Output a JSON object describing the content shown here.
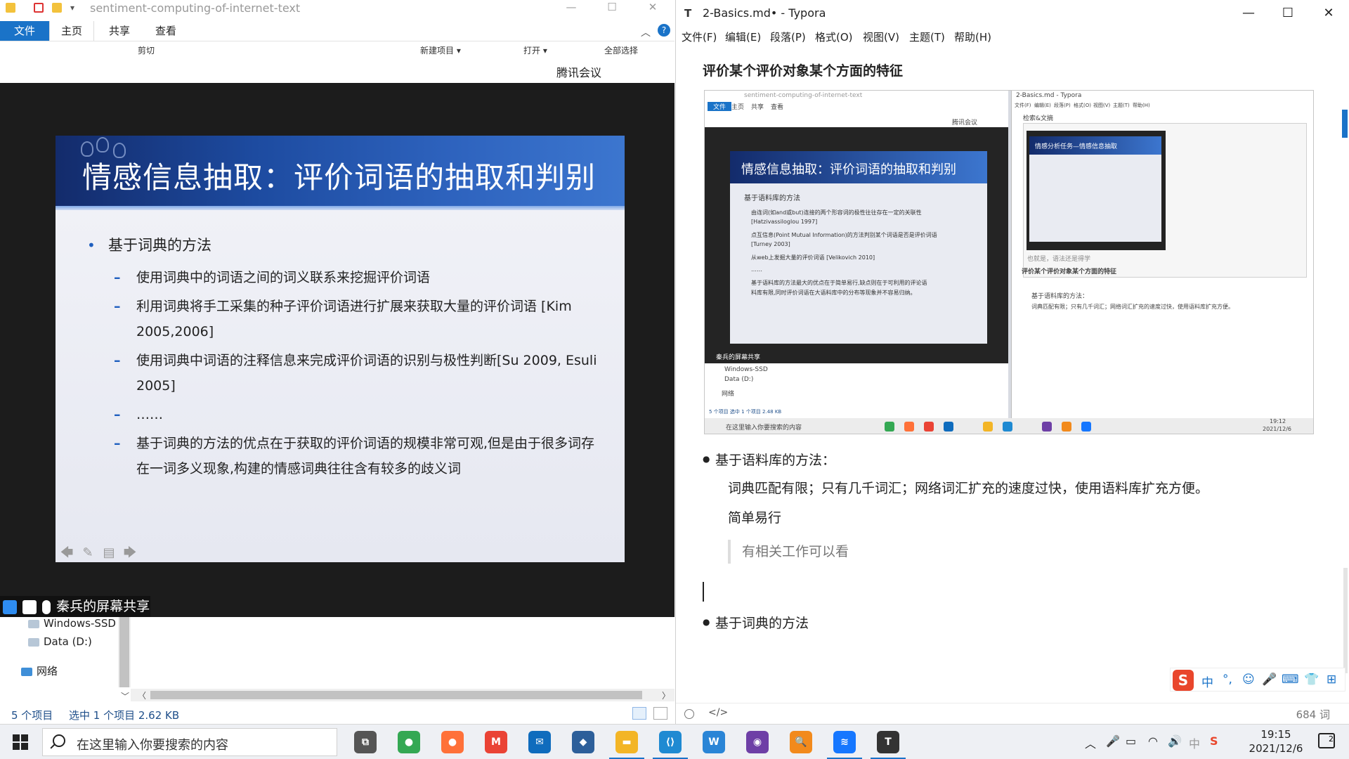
{
  "explorer": {
    "title": "sentiment-computing-of-internet-text",
    "ribbon_tabs": [
      "文件",
      "主页",
      "共享",
      "查看"
    ],
    "ribbon_items": [
      "剪切",
      "新建项目 ▾",
      "打开 ▾",
      "全部选择"
    ],
    "nav_items": [
      "Windows-SSD",
      "Data (D:)",
      "网络"
    ],
    "status_items": "5 个项目",
    "status_selected": "选中 1 个项目  2.62 KB"
  },
  "meeting": {
    "app_title": "腾讯会议",
    "share_label": "秦兵的屏幕共享"
  },
  "slide": {
    "title": "情感信息抽取：评价词语的抽取和判别",
    "bullet": "基于词典的方法",
    "subs": [
      "使用词典中的词语之间的词义联系来挖掘评价词语",
      "利用词典将手工采集的种子评价词语进行扩展来获取大量的评价词语 [Kim 2005,2006]",
      "使用词典中词语的注释信息来完成评价词语的识别与极性判断[Su 2009, Esuli 2005]",
      "……",
      "基于词典的方法的优点在于获取的评价词语的规模非常可观,但是由于很多词存在一词多义现象,构建的情感词典往往含有较多的歧义词"
    ]
  },
  "typora": {
    "title": "2-Basics.md• - Typora",
    "menu": [
      "文件(F)",
      "编辑(E)",
      "段落(P)",
      "格式(O)",
      "视图(V)",
      "主题(T)",
      "帮助(H)"
    ],
    "heading": "评价某个评价对象某个方面的特征",
    "bullet1": "基于语料库的方法：",
    "para1": "词典匹配有限；只有几千词汇；网络词汇扩充的速度过快，使用语料库扩充方便。",
    "para2": "简单易行",
    "quote": "有相关工作可以看",
    "bullet2": "基于词典的方法",
    "word_count": "684 词",
    "code_toggle": "</>",
    "ime_items": [
      "中",
      "°,",
      "☺",
      "🎤",
      "⌨",
      "👕",
      "⊞"
    ]
  },
  "embedded_screenshot": {
    "left_title": "sentiment-computing-of-internet-text",
    "left_tabs": [
      "文件",
      "主页",
      "共享",
      "查看"
    ],
    "meeting": "腾讯会议",
    "slide_title": "情感信息抽取：评价词语的抽取和判别",
    "slide_bullet": "基于语料库的方法",
    "slide_lines": [
      "由连词(如and或but)连接的两个形容词的极性往往存在一定的关联性",
      "[Hatzivassiloglou 1997]",
      "点互信息(Point Mutual Information)的方法判别某个词语是否是评价词语",
      "[Turney 2003]",
      "从web上发掘大量的评价词语 [Velikovich 2010]",
      "……",
      "基于语料库的方法最大的优点在于简单易行,缺点则在于可利用的评论语",
      "料库有限,同时评价词语在大语料库中的分布等现象并不容易归纳。"
    ],
    "share_label": "秦兵的屏幕共享",
    "nav_items": [
      "Windows-SSD",
      "Data (D:)",
      "网络"
    ],
    "status": "5 个项目   选中 1 个项目  2.48 KB",
    "search": "在这里输入你要搜索的内容",
    "right_title": "2-Basics.md - Typora",
    "right_menu": [
      "文件(F)",
      "编辑(E)",
      "段落(P)",
      "格式(O)",
      "视图(V)",
      "主题(T)",
      "帮助(H)"
    ],
    "right_heading1": "检索&文摘",
    "inner_slide_title": "情感分析任务—情感信息抽取",
    "right_note": "也就是，语法还是得学",
    "right_heading2": "评价某个评价对象某个方面的特征",
    "right_bullet": "基于语料库的方法：",
    "right_para": "词典匹配有限；只有几千词汇；网络词汇扩充的速度过快，使用语料库扩充方便。",
    "time": "19:12",
    "date": "2021/12/6"
  },
  "taskbar": {
    "search_placeholder": "在这里输入你要搜索的内容",
    "apps": [
      {
        "name": "task-view",
        "color": "#555555",
        "glyph": "⧉"
      },
      {
        "name": "chrome",
        "color": "#34a853",
        "glyph": "●"
      },
      {
        "name": "firefox",
        "color": "#ff7139",
        "glyph": "●"
      },
      {
        "name": "gmail",
        "color": "#ea4335",
        "glyph": "M"
      },
      {
        "name": "mail",
        "color": "#0f6cbd",
        "glyph": "✉"
      },
      {
        "name": "virtualbox",
        "color": "#2d5f9a",
        "glyph": "◆"
      },
      {
        "name": "file-explorer",
        "color": "#f3b526",
        "glyph": "▬"
      },
      {
        "name": "vscode",
        "color": "#1f8ad2",
        "glyph": "⟨⟩"
      },
      {
        "name": "writer",
        "color": "#2a85d6",
        "glyph": "W"
      },
      {
        "name": "github",
        "color": "#6e3fa6",
        "glyph": "◉"
      },
      {
        "name": "search-tool",
        "color": "#f28a1c",
        "glyph": "🔍"
      },
      {
        "name": "tencent-meeting",
        "color": "#1677ff",
        "glyph": "≋"
      },
      {
        "name": "typora",
        "color": "#333333",
        "glyph": "T"
      }
    ],
    "time": "19:15",
    "date": "2021/12/6",
    "ime_lang": "中",
    "notification_count": "2"
  }
}
